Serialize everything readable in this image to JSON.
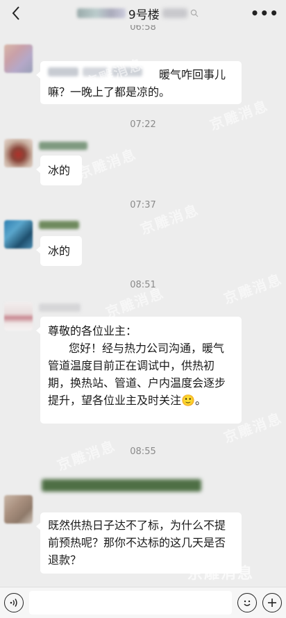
{
  "header": {
    "title_suffix": "9号楼",
    "more_label": "•••"
  },
  "messages": [
    {
      "type": "time",
      "text": "06:58"
    },
    {
      "type": "text",
      "text": "暖气咋回事儿嘛？一晚上了都是凉的。"
    },
    {
      "type": "time",
      "text": "07:22"
    },
    {
      "type": "text",
      "text": "冰的"
    },
    {
      "type": "time",
      "text": "07:37"
    },
    {
      "type": "text",
      "text": "冰的"
    },
    {
      "type": "time",
      "text": "08:51"
    },
    {
      "type": "text",
      "greeting": "尊敬的各位业主：",
      "body": "您好！经与热力公司沟通，暖气管道温度目前正在调试中，供热初期，换热站、管道、户内温度会逐步提升，望各位业主及时关注",
      "emoji": "🙂",
      "end": "。"
    },
    {
      "type": "time",
      "text": "08:55"
    },
    {
      "type": "text",
      "text": "既然供热日子达不了标，为什么不提前预热呢？那你不达标的这几天是否退款？"
    }
  ],
  "watermark": "京雕消息",
  "icons": {
    "back": "chevron-left-icon",
    "search": "search-icon",
    "more": "more-icon",
    "voice": "voice-icon",
    "emoji": "emoji-icon",
    "add": "add-icon"
  },
  "colors": {
    "background": "#ededed",
    "bubble": "#ffffff",
    "timestamp": "#8a8a8a"
  }
}
